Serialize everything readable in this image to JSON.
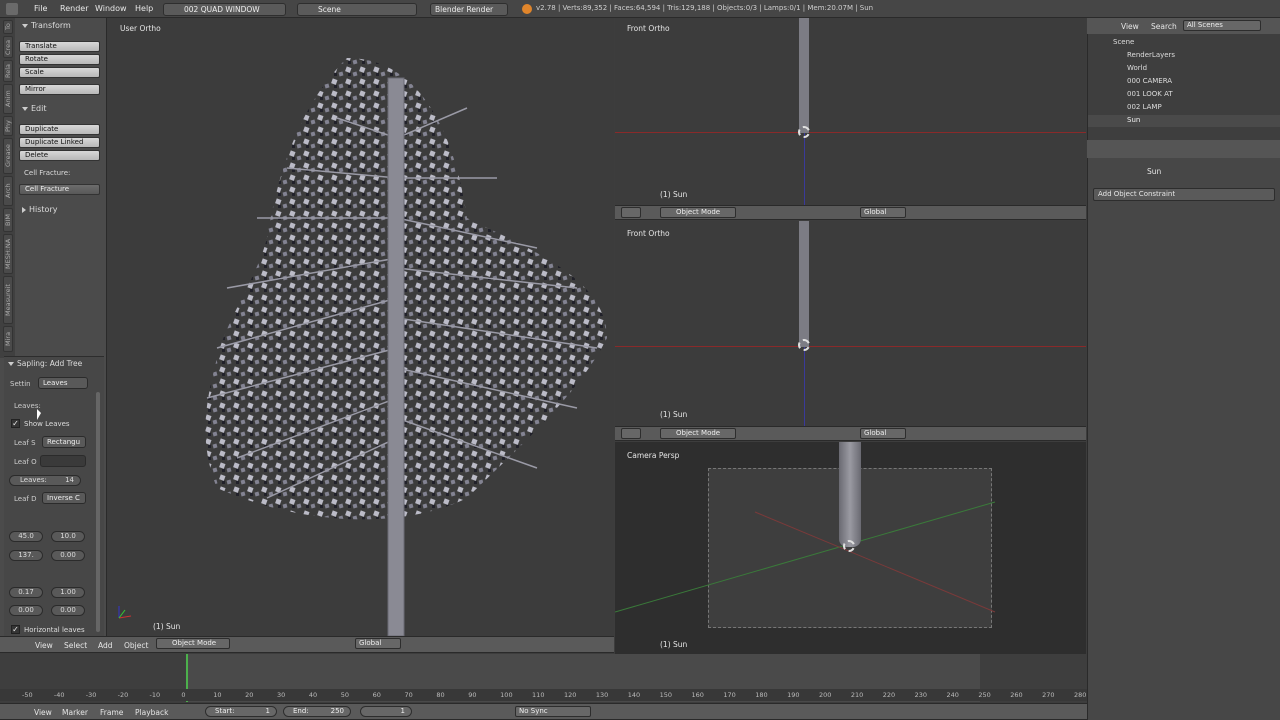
{
  "topbar": {
    "menus": [
      "File",
      "Render",
      "Window",
      "Help"
    ],
    "screen_layout": "002 QUAD WINDOW",
    "scene": "Scene",
    "engine": "Blender Render",
    "stats": "v2.78 | Verts:89,352 | Faces:64,594 | Tris:129,188 | Objects:0/3 | Lamps:0/1 | Mem:20.07M | Sun"
  },
  "toolshelf": {
    "vertical_tabs": [
      "To",
      "Crea",
      "Rela",
      "Anim",
      "Phy",
      "Grease",
      "Arch",
      "BIM",
      "MESH:NA",
      "Measureit",
      "Mira"
    ],
    "transform_header": "Transform",
    "transform_buttons": [
      "Translate",
      "Rotate",
      "Scale"
    ],
    "mirror": "Mirror",
    "edit_header": "Edit",
    "edit_buttons": [
      "Duplicate",
      "Duplicate Linked",
      "Delete"
    ],
    "cell_fracture_label": "Cell Fracture:",
    "cell_fracture_button": "Cell Fracture",
    "history_header": "History"
  },
  "sapling": {
    "header": "Sapling: Add Tree",
    "settings_label": "Settin",
    "settings_value": "Leaves",
    "leaves_label": "Leaves:",
    "show_leaves": "Show Leaves",
    "leaf_shape_label": "Leaf S",
    "leaf_shape_value": "Rectangu",
    "leaf_object_label": "Leaf O",
    "leaves_count_label": "Leaves:",
    "leaves_count_value": "14",
    "leaf_dist_label": "Leaf D",
    "leaf_dist_value": "Inverse C",
    "nums": [
      "45.0",
      "10.0",
      "137.",
      "0.00",
      "0.17",
      "1.00",
      "0.00",
      "0.00"
    ],
    "horizontal_leaves": "Horizontal leaves"
  },
  "viewports": {
    "main_label": "User Ortho",
    "main_object": "(1) Sun",
    "tr_label": "Front Ortho",
    "tr_object": "(1) Sun",
    "mr_label": "Front Ortho",
    "mr_object": "(1) Sun",
    "br_label": "Camera Persp",
    "br_object": "(1) Sun"
  },
  "view3d_header": {
    "menus": [
      "View",
      "Select",
      "Add",
      "Object"
    ],
    "mode": "Object Mode",
    "orientation": "Global"
  },
  "outliner": {
    "menus": [
      "View",
      "Search"
    ],
    "scope": "All Scenes",
    "rows": [
      "Scene",
      "RenderLayers",
      "World",
      "000 CAMERA",
      "001 LOOK AT",
      "002 LAMP",
      "Sun"
    ]
  },
  "properties": {
    "object": "Sun",
    "constraint_button": "Add Object Constraint"
  },
  "timeline": {
    "ticks": [
      "-50",
      "-40",
      "-30",
      "-20",
      "-10",
      "0",
      "10",
      "20",
      "30",
      "40",
      "50",
      "60",
      "70",
      "80",
      "90",
      "100",
      "110",
      "120",
      "130",
      "140",
      "150",
      "160",
      "170",
      "180",
      "190",
      "200",
      "210",
      "220",
      "230",
      "240",
      "250",
      "260",
      "270",
      "280"
    ],
    "menus": [
      "View",
      "Marker",
      "Frame",
      "Playback"
    ],
    "start_label": "Start:",
    "start_value": "1",
    "end_label": "End:",
    "end_value": "250",
    "current": "1",
    "sync": "No Sync"
  }
}
